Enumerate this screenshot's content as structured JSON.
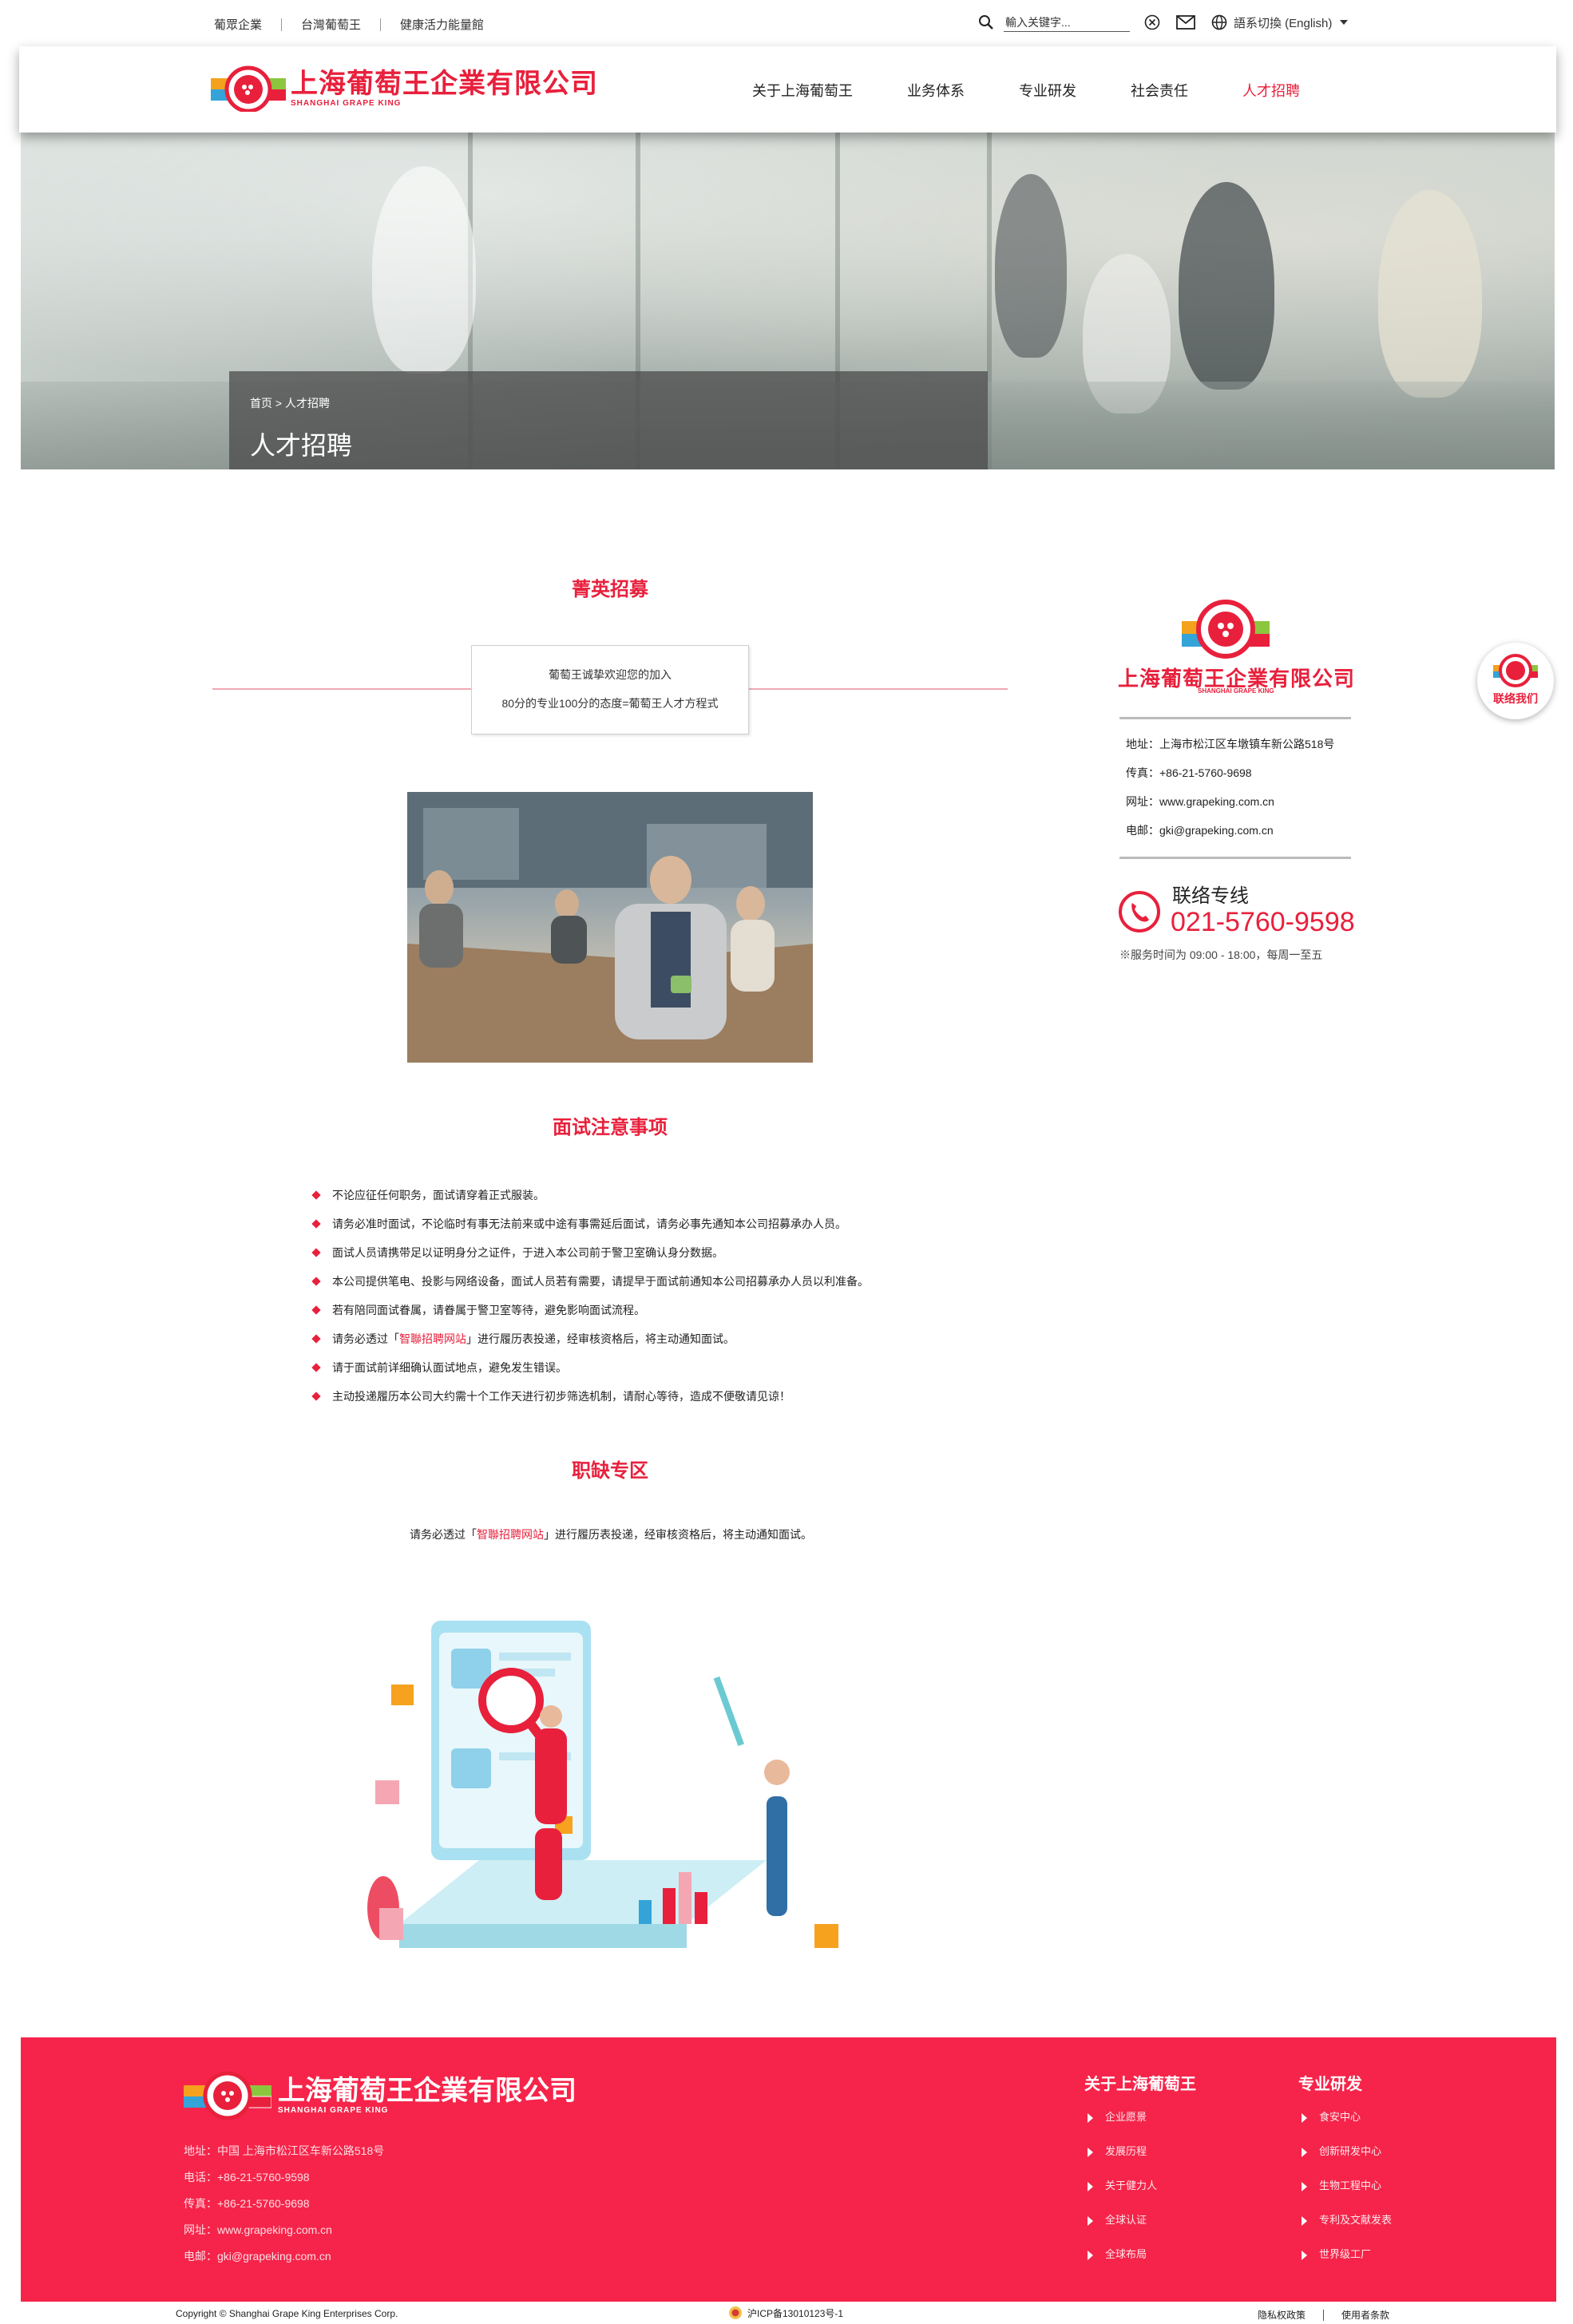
{
  "topbar": {
    "links": [
      "葡眾企業",
      "台灣葡萄王",
      "健康活力能量館"
    ],
    "search_placeholder": "輸入关键字...",
    "language_label": "語系切換 (English)"
  },
  "header": {
    "logo_cn": "上海葡萄王企業有限公司",
    "logo_en": "SHANGHAI GRAPE KING",
    "nav": [
      {
        "label": "关于上海葡萄王"
      },
      {
        "label": "业务体系"
      },
      {
        "label": "专业研发"
      },
      {
        "label": "社会责任"
      },
      {
        "label": "人才招聘"
      }
    ]
  },
  "hero": {
    "breadcrumb": "首页 > 人才招聘",
    "title": "人才招聘"
  },
  "recruit": {
    "title": "菁英招募",
    "intro_line1": "葡萄王诚挚欢迎您的加入",
    "intro_line2": "80分的专业100分的态度=葡萄王人才方程式"
  },
  "interview": {
    "title": "面试注意事项",
    "notes": [
      {
        "pre": "不论应征任何职务，面试请穿着正式服装。"
      },
      {
        "pre": "请务必准时面试，不论临时有事无法前来或中途有事需延后面试，请务必事先通知本公司招募承办人员。"
      },
      {
        "pre": "面试人员请携带足以证明身分之证件，于进入本公司前于警卫室确认身分数据。"
      },
      {
        "pre": "本公司提供笔电、投影与网络设备，面试人员若有需要，请提早于面试前通知本公司招募承办人员以利准备。"
      },
      {
        "pre": "若有陪同面试眷属，请眷属于警卫室等待，避免影响面试流程。"
      },
      {
        "pre": "请务必透过「",
        "link": "智聯招聘网站",
        "post": "」进行履历表投递，经审核资格后，将主动通知面试。"
      },
      {
        "pre": "请于面试前详细确认面试地点，避免发生错误。"
      },
      {
        "pre": "主动投递履历本公司大约需十个工作天进行初步筛选机制，请耐心等待，造成不便敬请见谅！"
      }
    ]
  },
  "jobs": {
    "title": "职缺专区",
    "text_pre": "请务必透过「",
    "text_link": "智聯招聘网站",
    "text_post": "」进行履历表投递，经审核资格后，将主动通知面试。"
  },
  "sidebar": {
    "logo_cn": "上海葡萄王企業有限公司",
    "logo_en": "SHANGHAI GRAPE KING",
    "address": "地址：上海市松江区车墩镇车新公路518号",
    "fax": "传真：+86-21-5760-9698",
    "website": "网址：www.grapeking.com.cn",
    "email": "电邮：gki@grapeking.com.cn",
    "hotline_label": "联络专线",
    "hotline_number": "021-5760-9598",
    "hotline_hours": "※服务时间为 09:00 - 18:00，每周一至五"
  },
  "float_contact": {
    "label": "联络我们"
  },
  "footer": {
    "logo_cn": "上海葡萄王企業有限公司",
    "logo_en": "SHANGHAI GRAPE KING",
    "contact": [
      "地址：中国 上海市松江区车新公路518号",
      "电话：+86-21-5760-9598",
      "传真：+86-21-5760-9698",
      "网址：www.grapeking.com.cn",
      "电邮：gki@grapeking.com.cn"
    ],
    "col1": {
      "head": "关于上海葡萄王",
      "items": [
        "企业愿景",
        "发展历程",
        "关于健力人",
        "全球认证",
        "全球布局"
      ]
    },
    "col2": {
      "head": "专业研发",
      "items": [
        "食安中心",
        "创新研发中心",
        "生物工程中心",
        "专利及文献发表",
        "世界级工厂"
      ]
    }
  },
  "bottom": {
    "copyright": "Copyright © Shanghai Grape King Enterprises Corp.",
    "icp": "沪ICP备13010123号-1",
    "privacy": "隐私权政策",
    "terms": "使用者条款"
  },
  "colors": {
    "brand_red": "#e8203c",
    "footer_red": "#f6244a"
  }
}
